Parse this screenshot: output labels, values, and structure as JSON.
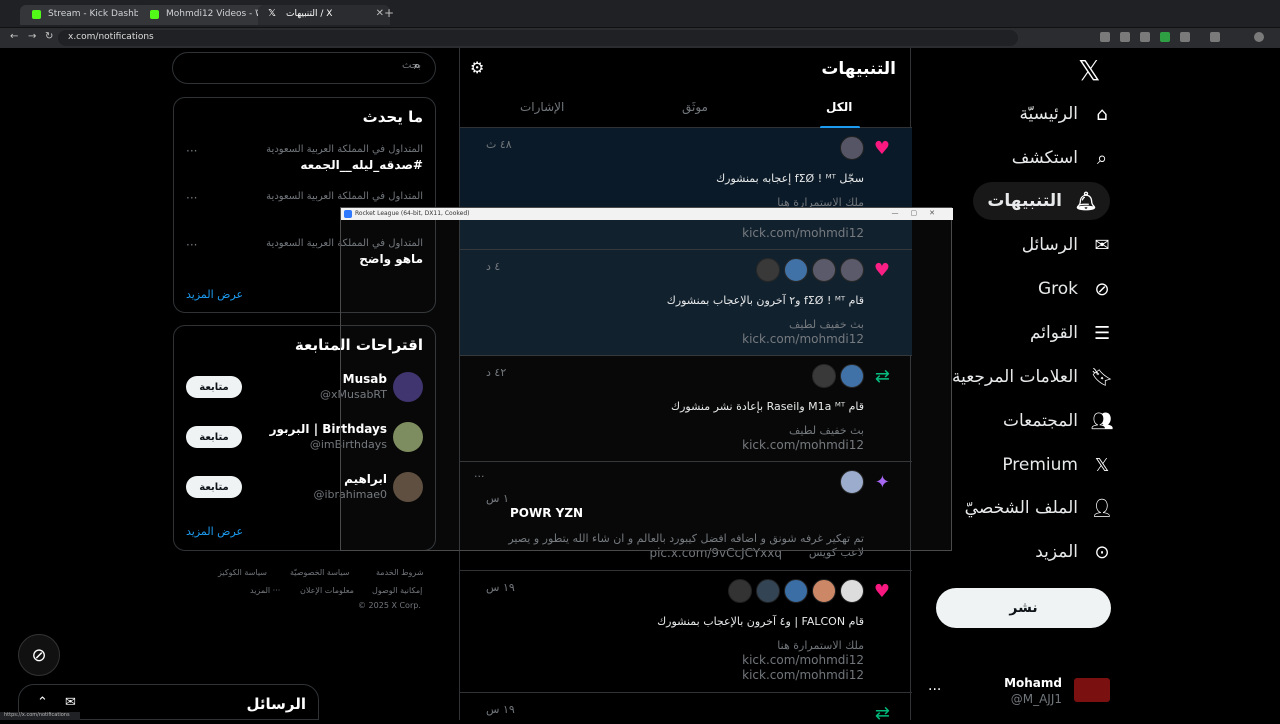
{
  "browser": {
    "tabs": [
      {
        "title": "Stream - Kick Dashboard"
      },
      {
        "title": "Mohmdi12 Videos - Watch On"
      },
      {
        "title": "التنبيهات / X"
      }
    ],
    "url": "x.com/notifications",
    "status_url": "https://x.com/notifications"
  },
  "nav": {
    "items": [
      "الرئيسيّة",
      "استكشف",
      "التنبيهات",
      "الرسائل",
      "Grok",
      "القوائم",
      "العلامات المرجعية",
      "المجتمعات",
      "Premium",
      "الملف الشخصيّ",
      "المزيد"
    ],
    "icons": [
      "home-icon",
      "search-icon",
      "bell-icon",
      "mail-icon",
      "grok-icon",
      "list-icon",
      "bookmark-icon",
      "communities-icon",
      "x-premium-icon",
      "person-icon",
      "more-circle-icon"
    ],
    "post_label": "نشر",
    "account_name": "Mohamd",
    "account_handle": "@M_AJJ1"
  },
  "main": {
    "title": "التنبيهات",
    "tabs": [
      "الكل",
      "موثَق",
      "الإشارات"
    ],
    "notifications": [
      {
        "time": "٤٨ ث",
        "text": "سجّل fΣØ ! ᴹᵀ إعجابه بمنشورك",
        "sub": "ملك الاستمرارة هنا",
        "link": "kick.com/mohmdi12"
      },
      {
        "time": "٤ د",
        "text": "قام fΣØ ! ᴹᵀ و٢ آخرون بالإعجاب بمنشورك",
        "sub": "بث خفيف لطيف",
        "link": "kick.com/mohmdi12"
      },
      {
        "time": "٤٢ د",
        "text": "قام M1a ᴹᵀ وRaseil بإعادة نشر منشورك",
        "sub": "بث خفيف لطيف",
        "link": "kick.com/mohmdi12"
      },
      {
        "time": "١ س",
        "title": "POWR YZN",
        "text": "تم تهكير غرفه شونق و اضافه افضل كيبورد بالعالم و ان شاء الله يتطور و يصير",
        "sub": "لاعب كويس",
        "link": "pic.x.com/9vCcJCYxxq"
      },
      {
        "time": "١٩ س",
        "text": "قام FALCON | و٤ آخرون بالإعجاب بمنشورك",
        "sub": "ملك الاستمرارة هنا",
        "link": "kick.com/mohmdi12",
        "link2": "kick.com/mohmdi12"
      },
      {
        "time": "١٩ س"
      }
    ]
  },
  "right": {
    "search_placeholder": "بحث",
    "trends_title": "ما يحدث",
    "trends": [
      {
        "meta": "المتداول في المملكة العربية السعودية",
        "name": "#صدقه_ليله__الجمعه"
      },
      {
        "meta": "المتداول في المملكة العربية السعودية",
        "name": ""
      },
      {
        "meta": "المتداول في المملكة العربية السعودية",
        "name": "ماهو واضح"
      }
    ],
    "show_more": "عرض المزيد",
    "suggestions_title": "اقتراحات المتابعة",
    "suggestions": [
      {
        "name": "Musab",
        "handle": "@xMusabRT",
        "button": "متابعة"
      },
      {
        "name": "البربور | Birthdays",
        "handle": "@imBirthdays",
        "button": "متابعة"
      },
      {
        "name": "ابراهيم",
        "handle": "@ibrahimae0",
        "button": "متابعة"
      }
    ],
    "footer": [
      "شروط الخدمة",
      "سياسة الخصوصيّة",
      "سياسة الكوكيز",
      "إمكانية الوصول",
      "معلومات الإعلان",
      "المزيد ···",
      "© 2025 X Corp."
    ]
  },
  "overlay": {
    "title": "Rocket League (64-bit, DX11, Cooked)"
  },
  "messages": {
    "title": "الرسائل"
  },
  "colors": {
    "accent": "#1d9bf0",
    "like": "#f91880",
    "repost": "#00ba7c",
    "premium": "#a463f2"
  }
}
